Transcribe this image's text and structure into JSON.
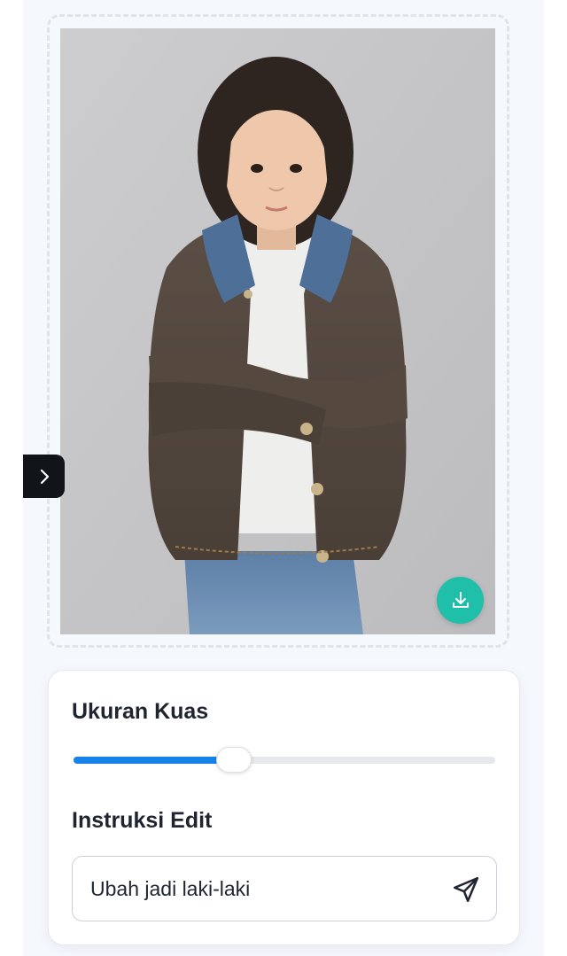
{
  "editor": {
    "image_alt": "Child in denim jacket",
    "download_icon": "download-icon",
    "expand_icon": "chevron-right-icon"
  },
  "controls": {
    "brush_size_label": "Ukuran Kuas",
    "brush_size_value": 0.38,
    "edit_instruction_label": "Instruksi Edit",
    "edit_instruction_value": "Ubah jadi laki-laki",
    "send_icon": "send-icon"
  },
  "colors": {
    "accent": "#1683ea",
    "download_button": "#1fbfaa",
    "page_background": "#f5f8fd"
  }
}
